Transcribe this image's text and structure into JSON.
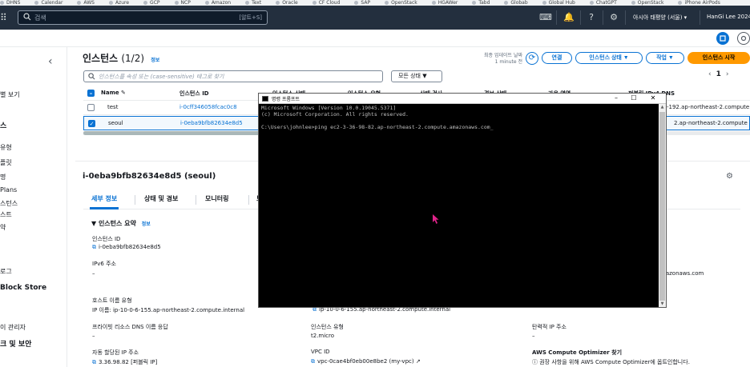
{
  "bookmarks": [
    "DHNS",
    "Calendar",
    "AWS",
    "Azure",
    "GCP",
    "NCP",
    "Amazon",
    "Text",
    "Oracle",
    "CF Cloud",
    "SAP",
    "OpenStack",
    "HGAWer",
    "Tabd",
    "Globab",
    "Global Hub",
    "ChatGPT",
    "OpenStack",
    "iPhone AirPods"
  ],
  "nav": {
    "search_placeholder": "검색",
    "search_shortcut": "[알트+S]",
    "region": "아시아 태평양 (서울) ▾",
    "user": "HanGi Lee 2024"
  },
  "sidebar": {
    "items": [
      {
        "label": "",
        "head": false
      },
      {
        "label": "별 보기",
        "head": false
      },
      {
        "label": "스",
        "head": true
      },
      {
        "label": "유형",
        "head": false
      },
      {
        "label": "플릿",
        "head": false
      },
      {
        "label": "명",
        "head": false
      },
      {
        "label": "Plans",
        "head": false
      },
      {
        "label": "스턴스",
        "head": false
      },
      {
        "label": "스트",
        "head": false
      },
      {
        "label": "약",
        "head": false
      },
      {
        "label": "로그",
        "head": false
      },
      {
        "label": "Block Store",
        "head": true
      },
      {
        "label": "이 관리자",
        "head": false
      },
      {
        "label": "크 및 보안",
        "head": true
      }
    ]
  },
  "instances": {
    "title": "인스턴스",
    "count": "(1/2)",
    "info": "정보",
    "updated_line1": "최종 업데이트 날짜",
    "updated_line2": "1 minute 전",
    "connect_label": "연결",
    "state_label": "인스턴스 상태 ▼",
    "actions_label": "작업 ▼",
    "launch_label": "인스턴스 시작",
    "filter_placeholder": "인스턴스를 속성 또는 (case-sensitive) 태그로 찾기",
    "state_filter": "모든 상태  ▼",
    "page": "1",
    "columns": [
      "Name ✎",
      "인스턴스 ID",
      "인스턴스 상태",
      "인스턴스 유형",
      "상태 검사",
      "경보 상태",
      "가용 영역",
      "퍼블릭 IPv4 DNS"
    ],
    "rows": [
      {
        "name": "test",
        "id": "i-0cff346058fcac0c8",
        "dns": "-192.ap-northeast-2.compute",
        "selected": false
      },
      {
        "name": "seoul",
        "id": "i-0eba9bfb82634e8d5",
        "dns": "2.ap-northeast-2.compute",
        "selected": true
      }
    ]
  },
  "detail": {
    "title": "i-0eba9bfb82634e8d5 (seoul)",
    "tabs": [
      "세부 정보",
      "상태 및 경보",
      "모니터링",
      "보"
    ],
    "summary_title": "▼ 인스턴스 요약",
    "summary_info": "정보",
    "fields": {
      "instance_id_label": "인스턴스 ID",
      "instance_id_value": "i-0eba9bfb82634e8d5",
      "ipv6_label": "IPv6 주소",
      "ipv6_value": "–",
      "hostname_type_label": "호스트 이름 유형",
      "hostname_type_value": "IP 이름: ip-10-0-6-155.ap-northeast-2.compute.internal",
      "private_dns_label": "프라이빗 리소스 DNS 이름 응답",
      "private_dns_value": "–",
      "elastic_ip_label": "자동 할당된 IP 주소",
      "elastic_ip_value": "3.36.98.82 [퍼블릭 IP]",
      "private_ip_value": "ip-10-0-6-155.ap-northeast-2.compute.internal",
      "instance_type_label": "인스턴스 유형",
      "instance_type_value": "t2.micro",
      "vpc_label": "VPC ID",
      "vpc_value": "vpc-0cae4bf0eb00e8be2 (my-vpc)",
      "public_dns_value": "mazonaws.com",
      "elastic_ip_addr_label": "탄력적 IP 주소",
      "elastic_ip_addr_value": "–",
      "optimizer_label": "AWS Compute Optimizer 찾기",
      "optimizer_value": "ⓘ 권장 사항을 위해 AWS Compute Optimizer에 옵트인합니다."
    }
  },
  "cmd": {
    "title": "명령 프롬프트",
    "line1": "Microsoft Windows [Version 10.0.19045.5371]",
    "line2": "(c) Microsoft Corporation. All rights reserved.",
    "line3": "",
    "line4": "C:\\Users\\johnlee>ping ec2-3-36-98-82.ap-northeast-2.compute.amazonaws.com_"
  },
  "colors": {
    "nav_bg": "#232f3e",
    "link": "#0972d3",
    "primary": "#ff9900"
  }
}
